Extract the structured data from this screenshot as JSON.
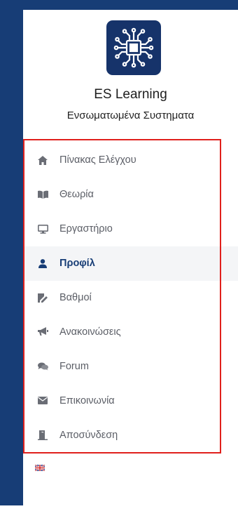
{
  "app": {
    "title": "ES Learning",
    "subtitle": "Ενσωματωμένα Συστηματα",
    "logo_icon": "circuit-chip-icon"
  },
  "menu": {
    "items": [
      {
        "label": "Πίνακας Ελέγχου",
        "icon": "home-icon",
        "active": false
      },
      {
        "label": "Θεωρία",
        "icon": "book-icon",
        "active": false
      },
      {
        "label": "Εργαστήριο",
        "icon": "desktop-icon",
        "active": false
      },
      {
        "label": "Προφίλ",
        "icon": "user-icon",
        "active": true
      },
      {
        "label": "Βαθμοί",
        "icon": "grade-edit-icon",
        "active": false
      },
      {
        "label": "Ανακοινώσεις",
        "icon": "bullhorn-icon",
        "active": false
      },
      {
        "label": "Forum",
        "icon": "comments-icon",
        "active": false
      },
      {
        "label": "Επικοινωνία",
        "icon": "envelope-icon",
        "active": false
      },
      {
        "label": "Αποσύνδεση",
        "icon": "door-exit-icon",
        "active": false
      }
    ]
  },
  "language": {
    "icon": "uk-flag-icon"
  },
  "colors": {
    "brand": "#173d76",
    "highlight_border": "#e0201c",
    "menu_text": "#5b5e66",
    "active_bg": "#f4f5f7"
  }
}
